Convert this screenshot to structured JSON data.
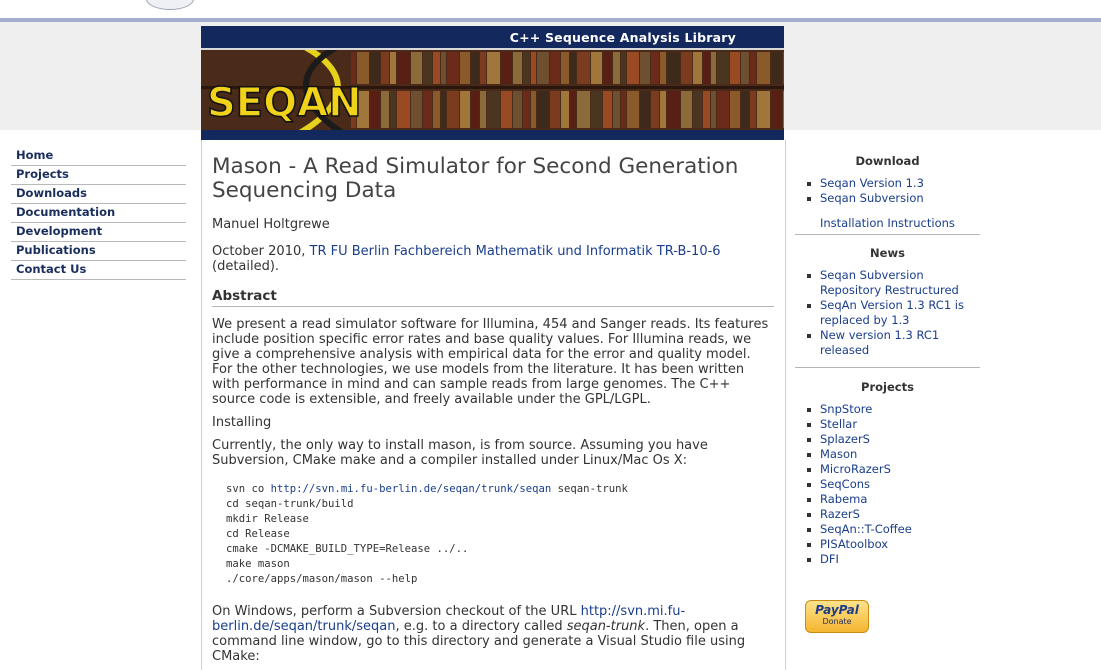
{
  "banner": {
    "title": "C++ Sequence Analysis Library",
    "logo_text": "SEQAN"
  },
  "nav": [
    "Home",
    "Projects",
    "Downloads",
    "Documentation",
    "Development",
    "Publications",
    "Contact Us"
  ],
  "main": {
    "title": "Mason - A Read Simulator for Second Generation Sequencing Data",
    "author": "Manuel Holtgrewe",
    "date_prefix": "October 2010, ",
    "date_link": "TR FU Berlin Fachbereich Mathematik und Informatik TR-B-10-6",
    "date_suffix": " (detailed).",
    "abstract_heading": "Abstract",
    "abstract_text": "We present a read simulator software for Illumina, 454 and Sanger reads. Its features include position specific error rates and base quality values. For Illumina reads, we give a comprehensive analysis with empirical data for the error and quality model. For the other technologies, we use models from the literature. It has been written with performance in mind and can sample reads from large genomes. The C++ source code is extensible, and freely available under the GPL/LGPL.",
    "installing_label": "Installing",
    "install_intro": "Currently, the only way to install mason, is from source. Assuming you have Subversion, CMake make and a compiler installed under Linux/Mac Os X:",
    "code": {
      "line1_prefix": "svn co ",
      "line1_link": "http://svn.mi.fu-berlin.de/seqan/trunk/seqan",
      "line1_suffix": " seqan-trunk",
      "line2": "cd seqan-trunk/build",
      "line3": "mkdir Release",
      "line4": "cd Release",
      "line5": "cmake -DCMAKE_BUILD_TYPE=Release ../..",
      "line6": "make mason",
      "line7": "./core/apps/mason/mason --help"
    },
    "windows_prefix": "On Windows, perform a Subversion checkout of the URL ",
    "windows_link": "http://svn.mi.fu-berlin.de/seqan/trunk/seqan",
    "windows_mid": ", e.g. to a directory called ",
    "windows_dir": "seqan-trunk",
    "windows_suffix": ". Then, open a command line window, go to this directory and generate a Visual Studio file using CMake:"
  },
  "sidebar": {
    "download_heading": "Download",
    "download_items": [
      "Seqan Version 1.3",
      "Seqan Subversion"
    ],
    "install_instructions": "Installation Instructions",
    "news_heading": "News",
    "news_items": [
      "Seqan Subversion Repository Restructured",
      "SeqAn Version 1.3 RC1 is replaced by 1.3",
      "New version 1.3 RC1 released"
    ],
    "projects_heading": "Projects",
    "projects_items": [
      "SnpStore",
      "Stellar",
      "SplazerS",
      "Mason",
      "MicroRazerS",
      "SeqCons",
      "Rabema",
      "RazerS",
      "SeqAn::T-Coffee",
      "PISAtoolbox",
      "DFI"
    ],
    "paypal_logo": "PayPal",
    "paypal_donate": "Donate"
  }
}
